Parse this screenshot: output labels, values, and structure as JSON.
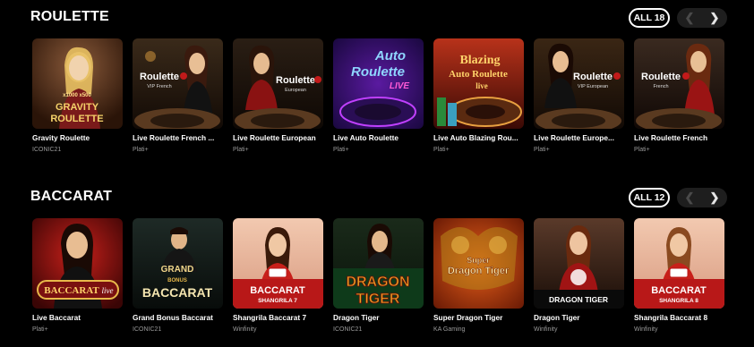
{
  "colors": {
    "background": "#000000",
    "accent_red": "#c21a1a",
    "gold": "#e8b84a"
  },
  "roulette": {
    "title": "ROULETTE",
    "all_label": "ALL 18",
    "prev_icon": "chevron-left-icon",
    "next_icon": "chevron-right-icon",
    "games": [
      {
        "name": "Gravity Roulette",
        "provider": "ICONIC21",
        "art_lines": [
          "GRAVITY",
          "ROULETTE"
        ],
        "art_small": "x1000  x500"
      },
      {
        "name": "Live Roulette French ...",
        "provider": "Plati+",
        "art_lines": [
          "Roulette"
        ],
        "art_small": "VIP French"
      },
      {
        "name": "Live Roulette European",
        "provider": "Plati+",
        "art_lines": [
          "Roulette"
        ],
        "art_small": "European"
      },
      {
        "name": "Live Auto Roulette",
        "provider": "Plati+",
        "art_lines": [
          "Auto",
          "Roulette"
        ],
        "art_small": "LIVE"
      },
      {
        "name": "Live Auto Blazing Rou...",
        "provider": "Plati+",
        "art_lines": [
          "Blazing",
          "Auto Roulette"
        ],
        "art_small": "live"
      },
      {
        "name": "Live Roulette Europe...",
        "provider": "Plati+",
        "art_lines": [
          "Roulette"
        ],
        "art_small": "VIP European"
      },
      {
        "name": "Live Roulette French",
        "provider": "Plati+",
        "art_lines": [
          "Roulette"
        ],
        "art_small": "French"
      }
    ]
  },
  "baccarat": {
    "title": "BACCARAT",
    "all_label": "ALL 12",
    "prev_icon": "chevron-left-icon",
    "next_icon": "chevron-right-icon",
    "games": [
      {
        "name": "Live Baccarat",
        "provider": "Plati+",
        "art_lines": [
          "BACCARAT"
        ],
        "art_small": "live"
      },
      {
        "name": "Grand Bonus Baccarat",
        "provider": "ICONIC21",
        "art_lines": [
          "GRAND",
          "BACCARAT"
        ],
        "art_small": "BONUS"
      },
      {
        "name": "Shangrila Baccarat 7",
        "provider": "Winfinity",
        "art_lines": [
          "BACCARAT"
        ],
        "art_small": "SHANGRILA 7"
      },
      {
        "name": "Dragon Tiger",
        "provider": "ICONIC21",
        "art_lines": [
          "DRAGON",
          "TIGER"
        ],
        "art_small": ""
      },
      {
        "name": "Super Dragon Tiger",
        "provider": "KA Gaming",
        "art_lines": [
          "Super",
          "Dragon Tiger"
        ],
        "art_small": ""
      },
      {
        "name": "Dragon Tiger",
        "provider": "Winfinity",
        "art_lines": [
          "DRAGON TIGER"
        ],
        "art_small": ""
      },
      {
        "name": "Shangrila Baccarat 8",
        "provider": "Winfinity",
        "art_lines": [
          "BACCARAT"
        ],
        "art_small": "SHANGRILA 8"
      }
    ]
  }
}
